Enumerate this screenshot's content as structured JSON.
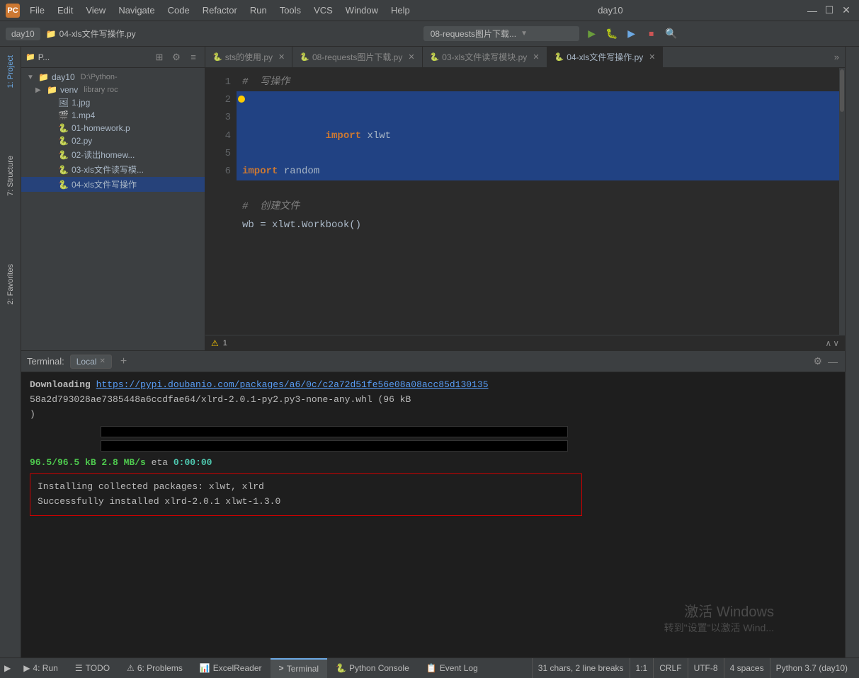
{
  "app": {
    "title": "day10",
    "icon_label": "PC"
  },
  "menu": {
    "items": [
      "File",
      "Edit",
      "View",
      "Navigate",
      "Code",
      "Refactor",
      "Run",
      "Tools",
      "VCS",
      "Window",
      "Help"
    ]
  },
  "window_controls": {
    "minimize": "—",
    "maximize": "☐",
    "close": "✕"
  },
  "navbar": {
    "project_label": "day10",
    "run_config": "08-requests图片下载...",
    "run_btn": "▶",
    "debug_btn": "🐛",
    "stop_btn": "⏹",
    "search_btn": "🔍"
  },
  "project_tree": {
    "header_label": "P...",
    "root_item": "day10",
    "root_path": "D:\\Python-",
    "venv_label": "venv",
    "venv_sub": "library roc",
    "files": [
      "1.jpg",
      "1.mp4",
      "01-homework.p",
      "02.py",
      "02-读出homew...",
      "03-xls文件读写模...",
      "04-xls文件写操作"
    ]
  },
  "editor_tabs": [
    {
      "label": "sts的使用.py",
      "active": false
    },
    {
      "label": "08-requests图片下载.py",
      "active": false
    },
    {
      "label": "03-xls文件读写模块.py",
      "active": false
    },
    {
      "label": "04-xls文件写操作.py",
      "active": true
    }
  ],
  "code": {
    "lines": [
      {
        "num": 1,
        "text": "#  写操作",
        "type": "comment",
        "highlighted": false
      },
      {
        "num": 2,
        "text": "import xlwt",
        "type": "import",
        "highlighted": true,
        "debug": true
      },
      {
        "num": 3,
        "text": "import random",
        "type": "import",
        "highlighted": true
      },
      {
        "num": 4,
        "text": "",
        "type": "empty",
        "highlighted": false
      },
      {
        "num": 5,
        "text": "#  创建文件",
        "type": "comment",
        "highlighted": false
      },
      {
        "num": 6,
        "text": "wb = xlwt.Workbook()",
        "type": "code",
        "highlighted": false
      }
    ]
  },
  "warning_bar": {
    "icon": "⚠",
    "count": "1",
    "up_arrow": "∧",
    "down_arrow": "∨"
  },
  "terminal": {
    "label": "Terminal:",
    "tabs": [
      {
        "label": "Local",
        "active": true
      }
    ],
    "add_btn": "+",
    "settings_btn": "⚙",
    "minimize_btn": "—",
    "content": {
      "line1_prefix": "Downloading ",
      "line1_link": "https://pypi.doubanio.com/packages/a6/0c/c2a72d51fe56e08a08acc85d130135",
      "line2": "58a2d793028ae7385448a6ccdfae64/xlrd-2.0.1-py2.py3-none-any.whl (96 kB",
      "line3": ")",
      "progress_label": "96.5/96.5 kB 2.8 MB/s",
      "eta_label": "eta",
      "eta_value": "0:00:00",
      "install_line1": "Installing collected packages: xlwt, xlrd",
      "install_line2": "Successfully installed xlrd-2.0.1 xlwt-1.3.0"
    }
  },
  "statusbar": {
    "tabs": [
      {
        "label": "4: Run",
        "icon": "▶"
      },
      {
        "label": "TODO",
        "icon": "☰"
      },
      {
        "label": "6: Problems",
        "icon": "⚠"
      },
      {
        "label": "ExcelReader",
        "icon": "📊"
      },
      {
        "label": "Terminal",
        "icon": ">"
      },
      {
        "label": "Python Console",
        "icon": "🐍"
      },
      {
        "label": "Event Log",
        "icon": "📋"
      }
    ],
    "active_tab": "Terminal",
    "right": {
      "chars": "31 chars, 2 line breaks",
      "position": "1:1",
      "line_ending": "CRLF",
      "encoding": "UTF-8",
      "indent": "4 spaces",
      "interpreter": "Python 3.7 (day10)"
    }
  },
  "left_sidebar_tabs": [
    {
      "label": "1: Project"
    },
    {
      "label": "7: Structure"
    },
    {
      "label": "2: Favorites"
    }
  ],
  "watermark": {
    "line1": "激活 Windows",
    "line2": "转到\"设置\"以激活 Wind..."
  }
}
